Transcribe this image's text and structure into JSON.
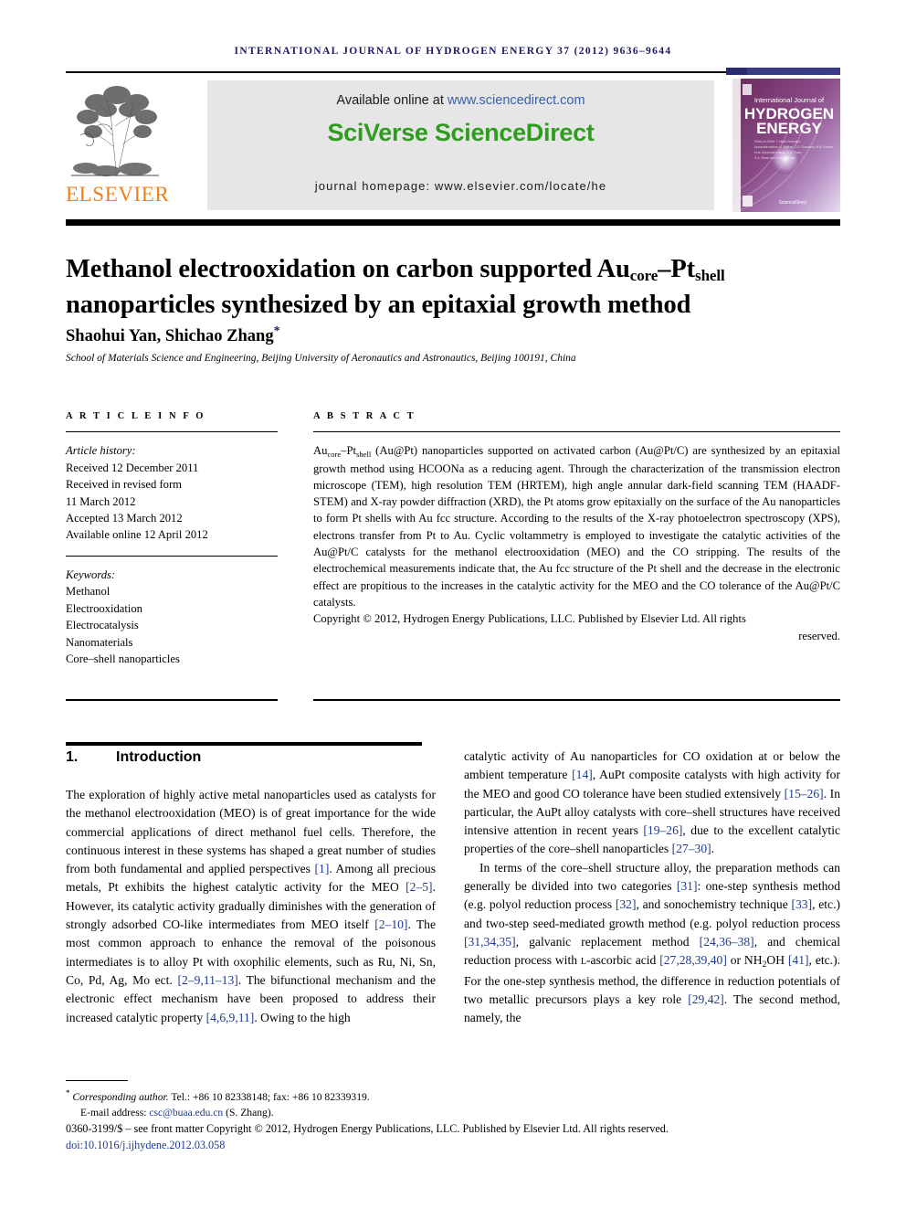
{
  "running_head": "International Journal of Hydrogen Energy 37 (2012) 9636–9644",
  "masthead": {
    "publisher_logo_text": "ELSEVIER",
    "available_prefix": "Available online at ",
    "available_url": "www.sciencedirect.com",
    "brand": "SciVerse ScienceDirect",
    "homepage": "journal homepage: www.elsevier.com/locate/he",
    "cover": {
      "line1": "International Journal of",
      "line2": "HYDROGEN",
      "line3": "ENERGY",
      "editors_label": "Editor-in-Chief:",
      "editors_line1": "T. Nejat Veziroğlu",
      "editors_line2": "A. Bigliosi, D.Y. Goswami, M.A. Savoia,",
      "editors_line3": "et al. Associate editors, D.K. Ross,",
      "editors_line4": "S.A. Sherif and S.A. Veziroğlu",
      "footer_brand": "ScienceDirect"
    }
  },
  "title_parts": {
    "line1_a": "Methanol electrooxidation on carbon supported Au",
    "line1_sub1": "core",
    "line1_b": "–Pt",
    "line1_sub2": "shell",
    "line2": "nanoparticles synthesized by an epitaxial growth method"
  },
  "authors": "Shaohui Yan, Shichao Zhang",
  "author_star": "*",
  "affiliation": "School of Materials Science and Engineering, Beijing University of Aeronautics and Astronautics, Beijing 100191, China",
  "article_info": {
    "heading": "A R T I C L E   I N F O",
    "history_label": "Article history:",
    "history": [
      "Received 12 December 2011",
      "Received in revised form",
      "11 March 2012",
      "Accepted 13 March 2012",
      "Available online 12 April 2012"
    ],
    "keywords_label": "Keywords:",
    "keywords": [
      "Methanol",
      "Electrooxidation",
      "Electrocatalysis",
      "Nanomaterials",
      "Core–shell nanoparticles"
    ]
  },
  "abstract": {
    "heading": "A B S T R A C T",
    "lead_a": "Au",
    "lead_sub1": "core",
    "lead_b": "–Pt",
    "lead_sub2": "shell",
    "body": " (Au@Pt) nanoparticles supported on activated carbon (Au@Pt/C) are synthesized by an epitaxial growth method using HCOONa as a reducing agent. Through the characterization of the transmission electron microscope (TEM), high resolution TEM (HRTEM), high angle annular dark-field scanning TEM (HAADF-STEM) and X-ray powder diffraction (XRD), the Pt atoms grow epitaxially on the surface of the Au nanoparticles to form Pt shells with Au fcc structure. According to the results of the X-ray photoelectron spectroscopy (XPS), electrons transfer from Pt to Au. Cyclic voltammetry is employed to investigate the catalytic activities of the Au@Pt/C catalysts for the methanol electrooxidation (MEO) and the CO stripping. The results of the electrochemical measurements indicate that, the Au fcc structure of the Pt shell and the decrease in the electronic effect are propitious to the increases in the catalytic activity for the MEO and the CO tolerance of the Au@Pt/C catalysts.",
    "copyright": "Copyright © 2012, Hydrogen Energy Publications, LLC. Published by Elsevier Ltd. All rights",
    "copyright_last": "reserved."
  },
  "section": {
    "number": "1.",
    "title": "Introduction"
  },
  "body_left": {
    "p1_before1": "The exploration of highly active metal nanoparticles used as catalysts for the methanol electrooxidation (MEO) is of great importance for the wide commercial applications of direct methanol fuel cells. Therefore, the continuous interest in these systems has shaped a great number of studies from both fundamental and applied perspectives ",
    "r1": "[1]",
    "p1_mid1": ". Among all precious metals, Pt exhibits the highest catalytic activity for the MEO ",
    "r2": "[2–5]",
    "p1_mid2": ". However, its catalytic activity gradually diminishes with the generation of strongly adsorbed CO-like intermediates from MEO itself ",
    "r3": "[2–10]",
    "p1_mid3": ". The most common approach to enhance the removal of the poisonous intermediates is to alloy Pt with oxophilic elements, such as Ru, Ni, Sn, Co, Pd, Ag, Mo ect. ",
    "r4": "[2–9,11–13]",
    "p1_mid4": ". The bifunctional mechanism and the electronic effect mechanism have been proposed to address their increased catalytic property ",
    "r5": "[4,6,9,11]",
    "p1_end": ". Owing to the high"
  },
  "body_right": {
    "p1_cont_a": "catalytic activity of Au nanoparticles for CO oxidation at or below the ambient temperature ",
    "r14": "[14]",
    "p1_cont_b": ", AuPt composite catalysts with high activity for the MEO and good CO tolerance have been studied extensively ",
    "r15": "[15–26]",
    "p1_cont_c": ". In particular, the AuPt alloy catalysts with core–shell structures have received intensive attention in recent years ",
    "r19": "[19–26]",
    "p1_cont_d": ", due to the excellent catalytic properties of the core–shell nanoparticles ",
    "r27": "[27–30]",
    "p1_cont_e": ".",
    "p2_a": "In terms of the core–shell structure alloy, the preparation methods can generally be divided into two categories ",
    "r31": "[31]",
    "p2_b": ": one-step synthesis method (e.g. polyol reduction process ",
    "r32": "[32]",
    "p2_c": ", and sonochemistry technique ",
    "r33": "[33]",
    "p2_d": ", etc.) and two-step seed-mediated growth method (e.g. polyol reduction process ",
    "r3134": "[31,34,35]",
    "p2_e": ", galvanic replacement method ",
    "r2436": "[24,36–38]",
    "p2_f": ", and chemical reduction process with ",
    "p2_lascorbic": "l",
    "p2_g": "-ascorbic acid ",
    "r2728": "[27,28,39,40]",
    "p2_h": " or NH",
    "p2_sub": "2",
    "p2_i": "OH ",
    "r41": "[41]",
    "p2_j": ", etc.). For the one-step synthesis method, the difference in reduction potentials of two metallic precursors plays a key role ",
    "r2942": "[29,42]",
    "p2_k": ". The second method, namely, the"
  },
  "footnotes": {
    "star": "*",
    "corresponding_label": "Corresponding author.",
    "corresponding_rest": " Tel.: +86 10 82338148; fax: +86 10 82339319.",
    "email_label": "E-mail address:",
    "email": "csc@buaa.edu.cn",
    "email_after": " (S. Zhang).",
    "imprint": "0360-3199/$ – see front matter Copyright © 2012, Hydrogen Energy Publications, LLC. Published by Elsevier Ltd. All rights reserved.",
    "doi": "doi:10.1016/j.ijhydene.2012.03.058"
  },
  "colors": {
    "running_head": "#1a1a66",
    "elsevier_orange": "#ef7f1a",
    "sciencedirect_green": "#2f9c1f",
    "link_blue": "#3b5fa8",
    "reference_blue": "#1f3a93"
  }
}
